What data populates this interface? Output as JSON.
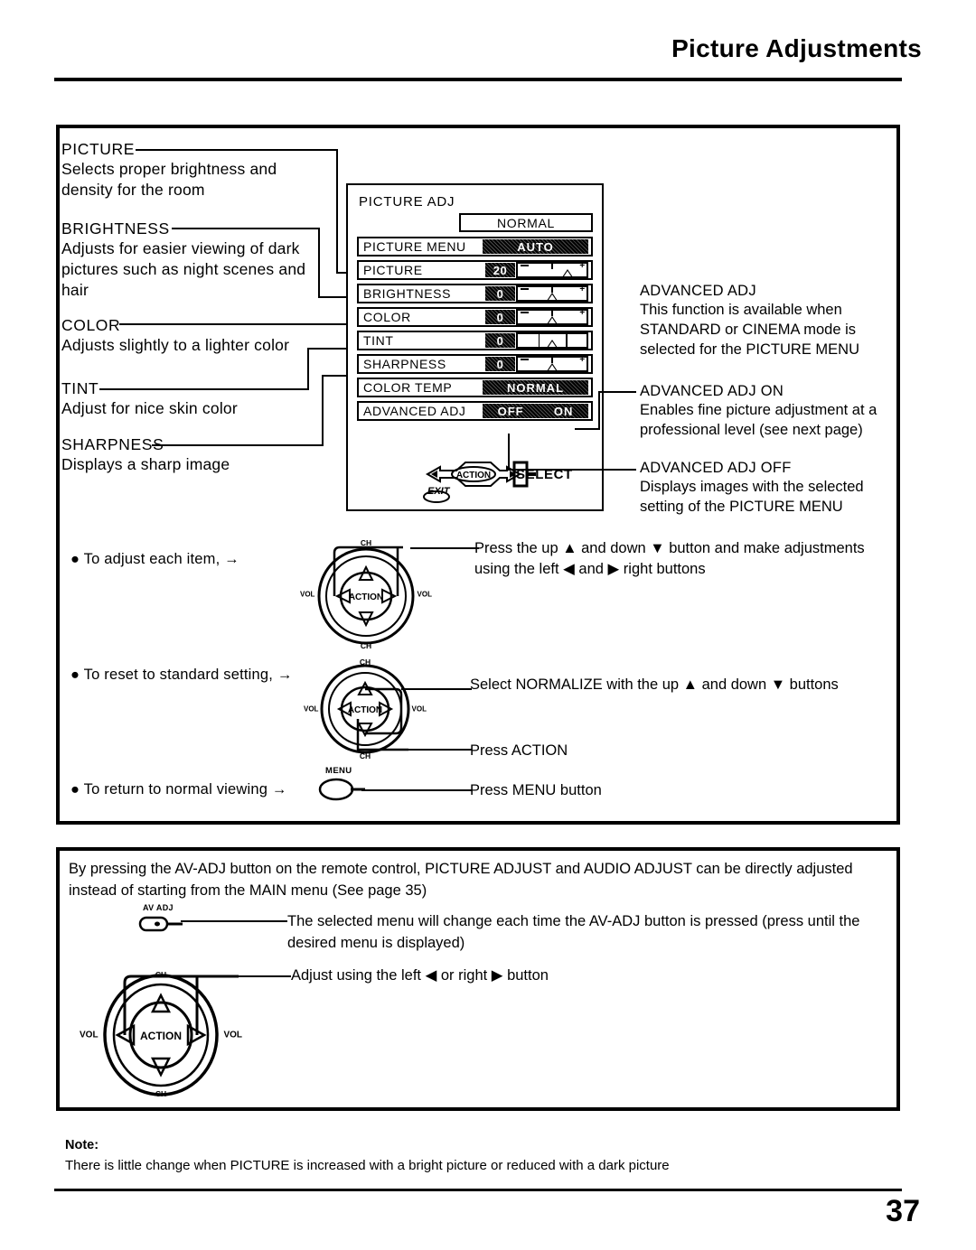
{
  "header": {
    "title": "Picture Adjustments"
  },
  "page_number": "37",
  "left_descriptions": [
    {
      "name": "picture",
      "heading": "PICTURE",
      "body": "Selects proper brightness and density for the room"
    },
    {
      "name": "brightness",
      "heading": "BRIGHTNESS",
      "body": "Adjusts for easier viewing of dark pictures such as night scenes and hair"
    },
    {
      "name": "color",
      "heading": "COLOR",
      "body": "Adjusts slightly to a lighter color"
    },
    {
      "name": "tint",
      "heading": "TINT",
      "body": "Adjust for nice skin color"
    },
    {
      "name": "sharpness",
      "heading": "SHARPNESS",
      "body": "Displays a sharp image"
    }
  ],
  "right_descriptions": [
    {
      "name": "advanced-adj",
      "heading": "ADVANCED ADJ",
      "body": "This function is available when STANDARD or CINEMA mode is selected for the PICTURE MENU"
    },
    {
      "name": "advanced-adj-on",
      "heading": "ADVANCED ADJ ON",
      "body": "Enables fine picture adjustment at a professional level  (see next page)"
    },
    {
      "name": "advanced-adj-off",
      "heading": "ADVANCED ADJ OFF",
      "body": "Displays images with the selected setting of the PICTURE MENU"
    }
  ],
  "osd": {
    "title": "PICTURE ADJ",
    "normalize_button": "NORMAL",
    "rows": [
      {
        "label": "PICTURE MENU",
        "type": "mode",
        "value": "AUTO"
      },
      {
        "label": "PICTURE",
        "type": "slider",
        "value": "20",
        "knob_pct": 72
      },
      {
        "label": "BRIGHTNESS",
        "type": "slider",
        "value": "0",
        "knob_pct": 50
      },
      {
        "label": "COLOR",
        "type": "slider",
        "value": "0",
        "knob_pct": 50
      },
      {
        "label": "TINT",
        "type": "slider",
        "value": "0",
        "knob_pct": 50
      },
      {
        "label": "SHARPNESS",
        "type": "slider",
        "value": "0",
        "knob_pct": 50
      },
      {
        "label": "COLOR TEMP",
        "type": "mode",
        "value": "NORMAL"
      },
      {
        "label": "ADVANCED ADJ",
        "type": "toggle",
        "value": "OFF",
        "value2": "ON"
      }
    ],
    "select_label": "SELECT",
    "action_label": "ACTION",
    "exit_label": "EXIT"
  },
  "procedure": {
    "bullets": [
      "● To adjust each item,  →",
      "● To reset to standard setting,   →",
      "● To return to  normal viewing  →"
    ],
    "instructions": [
      "Press the up ▲ and down ▼ button and make adjustments using the left ◀ and ▶ right  buttons",
      "Select NORMALIZE with the up ▲ and down ▼ buttons",
      "Press ACTION",
      "Press MENU button"
    ],
    "menu_button_label": "MENU"
  },
  "remote": {
    "action_label": "ACTION",
    "vol_label": "VOL",
    "ch_label": "CH"
  },
  "avadj_box": {
    "paragraph": "By pressing the AV-ADJ button on the remote control, PICTURE ADJUST and AUDIO ADJUST can be directly adjusted instead of starting from the MAIN menu (See page 35)",
    "button_label": "AV ADJ",
    "line1": "The selected menu will change each time the AV-ADJ button is pressed (press until the desired menu is displayed)",
    "line2": "Adjust using the left ◀ or right ▶ button"
  },
  "note": {
    "heading": "Note:",
    "text": "There is little change when PICTURE is increased with a bright picture or reduced with a dark picture"
  }
}
